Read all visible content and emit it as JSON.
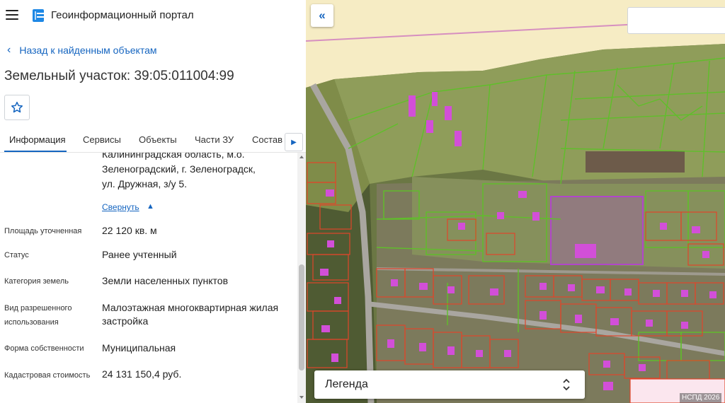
{
  "app": {
    "title": "Геоинформационный портал",
    "menu_icon": "hamburger-icon",
    "logo_icon": "portal-logo-icon"
  },
  "nav": {
    "back_label": "Назад к найденным объектам"
  },
  "object": {
    "title": "Земельный участок: 39:05:011004:99"
  },
  "tabs": [
    {
      "label": "Информация",
      "active": true
    },
    {
      "label": "Сервисы",
      "active": false
    },
    {
      "label": "Объекты",
      "active": false
    },
    {
      "label": "Части ЗУ",
      "active": false
    },
    {
      "label": "Состав",
      "active": false
    }
  ],
  "info": {
    "address_lines": [
      "Калининградская область, м.о.",
      "Зеленоградский, г. Зеленоградск,",
      "ул. Дружная, з/у 5."
    ],
    "collapse_label": "Свернуть",
    "rows": [
      {
        "label": "Площадь уточненная",
        "value": "22 120 кв. м"
      },
      {
        "label": "Статус",
        "value": "Ранее учтенный"
      },
      {
        "label": "Категория земель",
        "value": "Земли населенных пунктов"
      },
      {
        "label": "Вид разрешенного использования",
        "value": "Малоэтажная многоквартирная жилая застройка"
      },
      {
        "label": "Форма собственности",
        "value": "Муниципальная"
      },
      {
        "label": "Кадастровая стоимость",
        "value": "24 131 150,4 руб."
      }
    ]
  },
  "map": {
    "legend_label": "Легенда",
    "attribution": "НСПД 2026",
    "search_placeholder": ""
  },
  "colors": {
    "accent": "#1565c0",
    "parcel_outline_green": "#4caf2a",
    "parcel_outline_red": "#e0452a",
    "selected_parcel": "#8e44ad",
    "building_fill": "#d24fd8"
  }
}
